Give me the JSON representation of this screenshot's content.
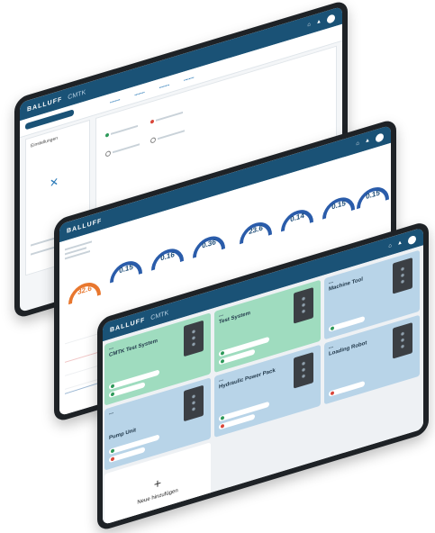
{
  "brand": "BALLUFF",
  "app_name": "CMTK",
  "colors": {
    "header": "#1a5276",
    "green_card": "#9fdcbf",
    "blue_card": "#b8d4e8",
    "gauge_orange": "#e8772e",
    "gauge_blue": "#2a5caa",
    "status_green": "#2e9a5a",
    "status_red": "#d9463a"
  },
  "settings_screen": {
    "heading": "Einstellungen"
  },
  "gauges": {
    "values": [
      "32.6",
      "0.15",
      "0.16",
      "0.36",
      "23.6",
      "0.14",
      "0.15",
      "0.15"
    ]
  },
  "systems_screen": {
    "cards": [
      {
        "title": "CMTK Test System",
        "style": "green"
      },
      {
        "title": "Test System",
        "style": "green"
      },
      {
        "title": "Machine Tool",
        "style": "blue"
      },
      {
        "title": "Pump Unit",
        "style": "blue"
      },
      {
        "title": "Hydraulic Power Pack",
        "style": "blue"
      },
      {
        "title": "Loading Robot",
        "style": "blue"
      }
    ],
    "add_new_label": "Neue hinzufügen"
  },
  "icons": [
    "home-icon",
    "notification-icon",
    "user-avatar-icon",
    "tool-icon",
    "plus-icon"
  ]
}
